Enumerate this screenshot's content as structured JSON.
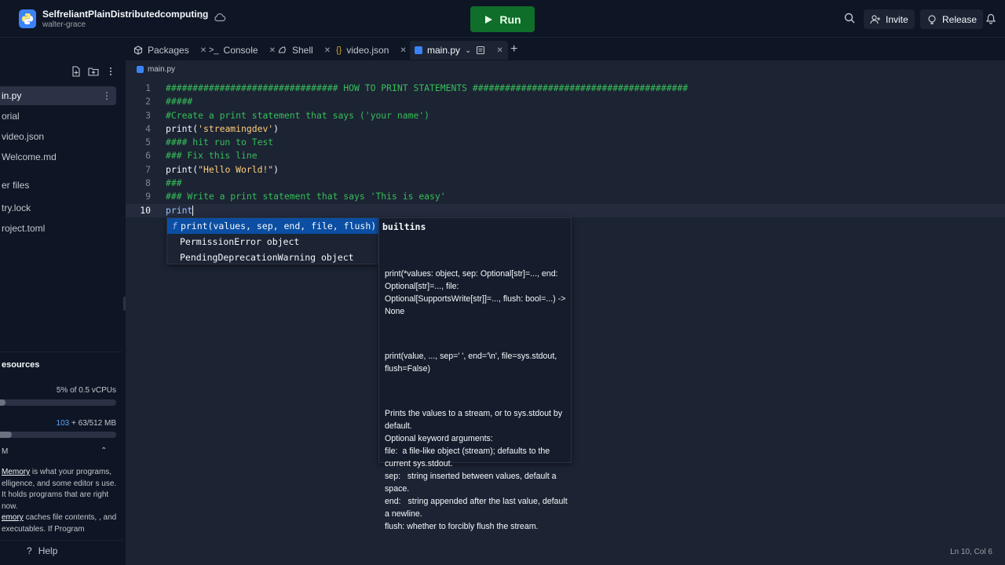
{
  "header": {
    "repl_name": "SelfreliantPlainDistributedcomputing",
    "owner": "walter-grace",
    "run_label": "Run",
    "invite_label": "Invite",
    "release_label": "Release"
  },
  "sidebar": {
    "files": [
      {
        "label": "in.py",
        "active": true
      },
      {
        "label": "orial"
      },
      {
        "label": "video.json"
      },
      {
        "label": "Welcome.md"
      },
      {
        "label": "er files"
      },
      {
        "label": "try.lock"
      },
      {
        "label": "roject.toml"
      }
    ],
    "resources_title": "esources",
    "cpu_label": "5% of 0.5 vCPUs",
    "cpu_fill": 0.05,
    "ram_blue": "103",
    "ram_rest": " + 63/512 MB",
    "ram_fill": 0.1,
    "ram_section": "M",
    "ram_text_1a": "Memory",
    "ram_text_1b": " is what your programs, elligence, and some editor s use. It holds programs that are right now.",
    "ram_text_2a": "emory",
    "ram_text_2b": " caches file contents, , and executables. If Program",
    "help_label": "Help"
  },
  "tabs": [
    {
      "label": "Packages"
    },
    {
      "label": "Console"
    },
    {
      "label": "Shell"
    },
    {
      "label": "video.json"
    },
    {
      "label": "main.py"
    }
  ],
  "editor": {
    "breadcrumb": "main.py",
    "lines": [
      "################################ HOW TO PRINT STATEMENTS ########################################",
      "#####",
      "#Create a print statement that says ('your name')",
      "print('streamingdev')",
      "#### hit run to Test",
      "### Fix this line",
      "print(\"Hello World!\")",
      "###",
      "### Write a print statement that says 'This is easy'",
      "print"
    ],
    "current_line": 10
  },
  "autocomplete": {
    "items": [
      {
        "icon": "f",
        "label": "print(values, sep, end, file, flush)"
      },
      {
        "label": "PermissionError object"
      },
      {
        "label": "PendingDeprecationWarning object"
      }
    ],
    "doc_title": "builtins",
    "doc_p1": "print(*values: object, sep: Optional[str]=..., end: Optional[str]=..., file: Optional[SupportsWrite[str]]=..., flush: bool=...) -> None",
    "doc_p2": "print(value, ..., sep=' ', end='\\n', file=sys.stdout, flush=False)",
    "doc_p3": "Prints the values to a stream, or to sys.stdout by default.\nOptional keyword arguments:\nfile:  a file-like object (stream); defaults to the current sys.stdout.\nsep:   string inserted between values, default a space.\nend:   string appended after the last value, default a newline.\nflush: whether to forcibly flush the stream."
  },
  "status": {
    "cursor": "Ln 10, Col 6"
  }
}
